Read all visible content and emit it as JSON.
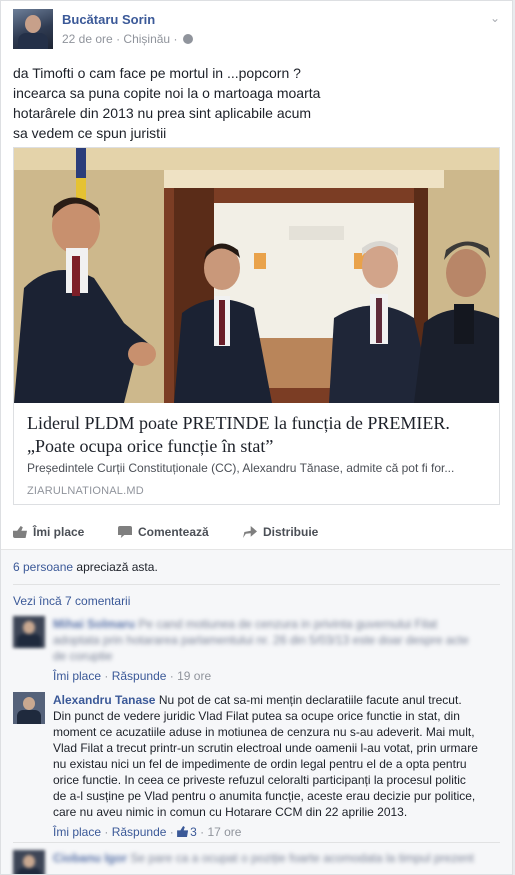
{
  "post": {
    "author": "Bucătaru Sorin",
    "time": "22 de ore",
    "location": "Chișinău",
    "separator": "·",
    "text_lines": [
      "da Timofti o cam face pe mortul in ...popcorn ?",
      "incearca sa puna copite noi la o martoaga moarta",
      "hotarârele din 2013 nu prea sint aplicabile acum",
      "sa vedem ce spun juristii"
    ]
  },
  "link": {
    "title": "Liderul PLDM poate PRETINDE la funcția de PREMIER. „Poate ocupa orice funcție în stat”",
    "description": "Președintele Curții Constituționale (CC), Alexandru Tănase, admite că pot fi for...",
    "domain": "ZIARULNATIONAL.MD"
  },
  "actions": {
    "like": "Îmi place",
    "comment": "Comentează",
    "share": "Distribuie"
  },
  "likes": {
    "count_link": "6 persoane",
    "suffix": "apreciază asta."
  },
  "more_comments": "Vezi încă 7 comentarii",
  "comments": [
    {
      "name": "Mihai Solmaru",
      "lines": [
        "Pe cand motiunea de cenzura in privinta guvernului Filat",
        "adoptata prin hotararea parlamentului nr. 26 din 5/03/13 este doar despre acte",
        "de coruptie"
      ],
      "like": "Îmi place",
      "reply": "Răspunde",
      "time": "19 ore"
    },
    {
      "name": "Alexandru Tanase",
      "first_line": "Nu pot de cat sa-mi mențin declaratiile facute anul trecut.",
      "lines": [
        "Din punct de vedere juridic Vlad Filat putea sa ocupe orice functie in stat, din",
        "moment ce acuzatiile aduse in motiunea de cenzura nu s-au adeverit. Mai mult,",
        "Vlad Filat a trecut printr-un scrutin electroal unde oamenii l-au votat, prin urmare",
        "nu existau nici un fel de impedimente de ordin legal pentru el de a opta pentru",
        "orice functie. In ceea ce priveste refuzul celoralti participanți la procesul politic",
        "de a-l susține pe Vlad pentru o anumita funcție, aceste erau decizie pur politice,",
        "care nu aveu nimic in comun cu Hotarare CCM din 22 aprilie 2013."
      ],
      "like": "Îmi place",
      "reply": "Răspunde",
      "like_count": "3",
      "time": "17 ore"
    },
    {
      "name": "Ciobanu Igor",
      "first_line": "Se pare ca a ocupat o poziție foarte acomodata la timpul prezent"
    }
  ],
  "colors": {
    "link_blue": "#3b5998",
    "meta_gray": "#90949c",
    "feedback_bg": "#f6f7f9"
  },
  "icons": {
    "privacy": "globe-icon",
    "menu": "chevron-down-icon",
    "like": "thumbs-up-icon",
    "comment": "speech-bubble-icon",
    "share": "share-arrow-icon"
  }
}
